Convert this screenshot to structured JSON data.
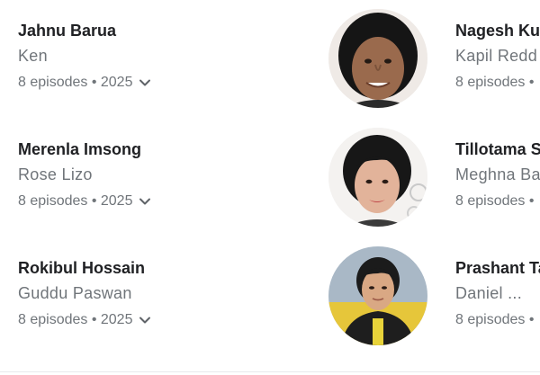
{
  "cast": [
    {
      "actor": "Jahnu Barua",
      "character": "Ken",
      "episodes": "8 episodes • 2025"
    },
    {
      "actor": "Nagesh Ku",
      "character": "Kapil Redd",
      "episodes": "8 episodes •"
    },
    {
      "actor": "Merenla Imsong",
      "character": "Rose Lizo",
      "episodes": "8 episodes • 2025"
    },
    {
      "actor": "Tillotama S",
      "character": "Meghna Ba",
      "episodes": "8 episodes •"
    },
    {
      "actor": "Rokibul Hossain",
      "character": "Guddu Paswan",
      "episodes": "8 episodes • 2025"
    },
    {
      "actor": "Prashant Ta",
      "character": "Daniel ...",
      "episodes": "8 episodes •"
    }
  ],
  "icons": {
    "expand": "chevron-down-icon"
  },
  "colors": {
    "name": "#202124",
    "secondary": "#70757a"
  }
}
